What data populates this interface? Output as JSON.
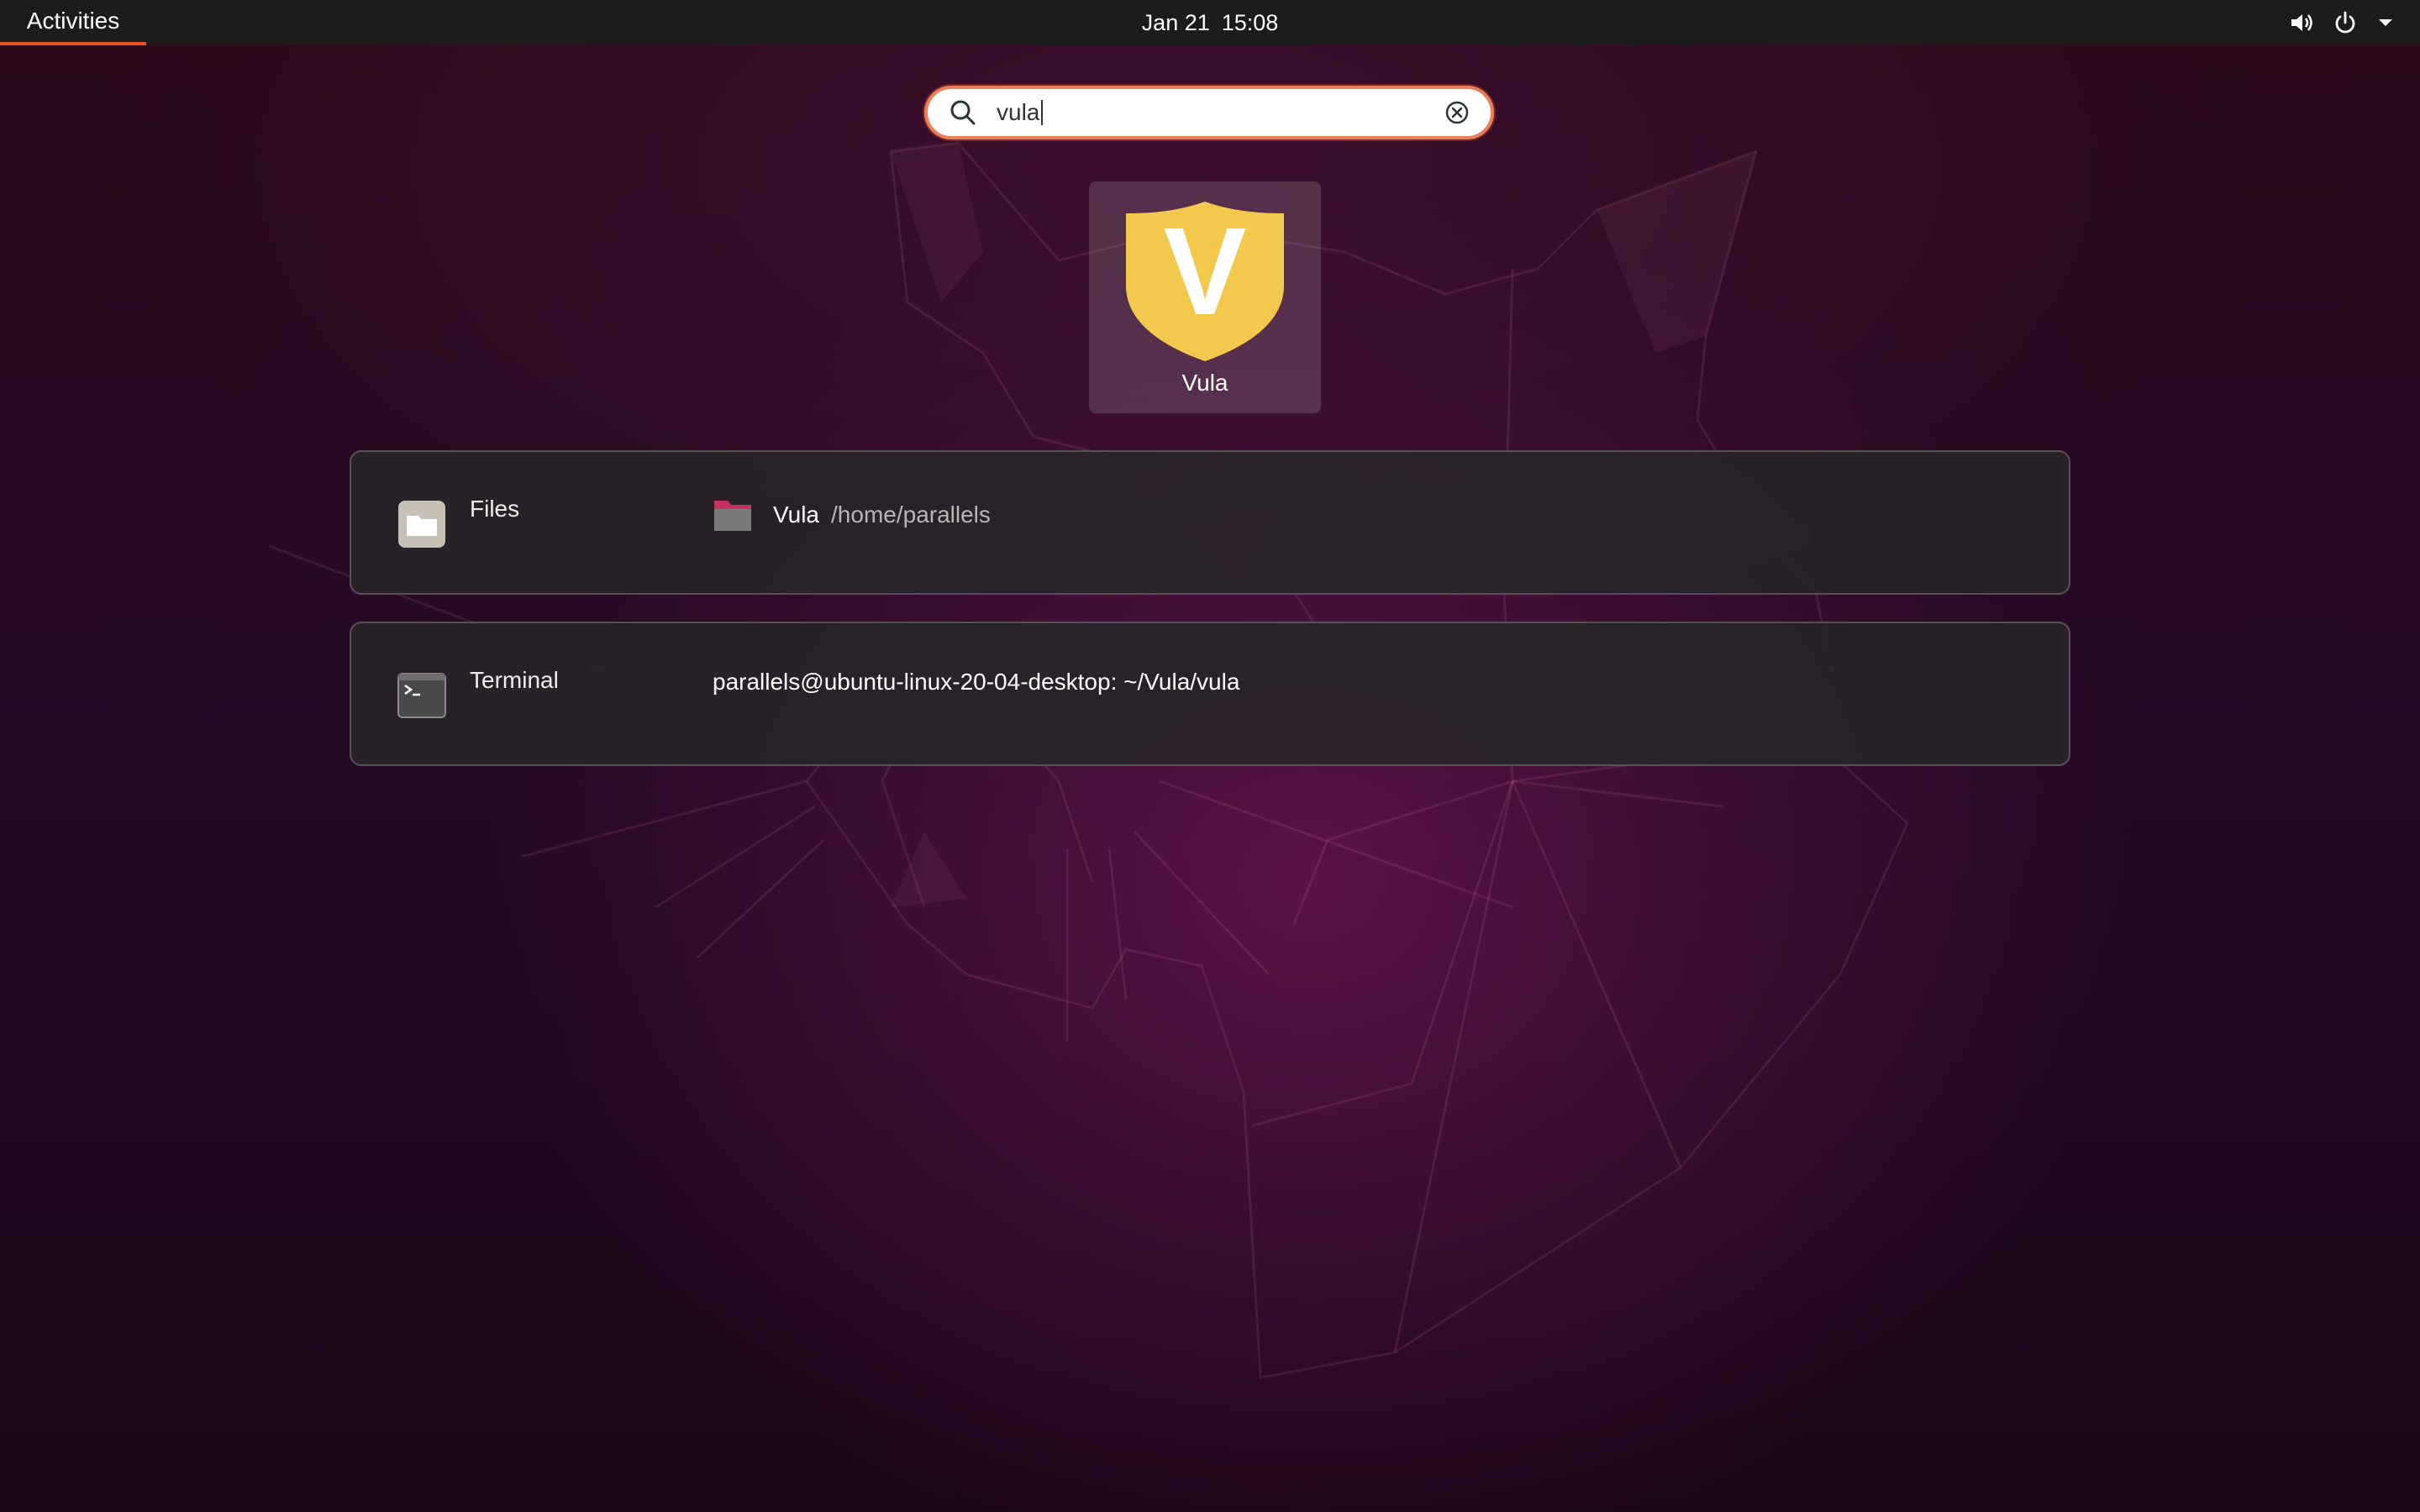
{
  "topbar": {
    "activities_label": "Activities",
    "date": "Jan 21",
    "time": "15:08",
    "tray_icons": [
      "volume-icon",
      "power-icon",
      "chevron-down-icon"
    ]
  },
  "search": {
    "query": "vula",
    "icons": [
      "search-icon",
      "clear-icon"
    ]
  },
  "app_result": {
    "name": "Vula",
    "icon_letter": "V",
    "icon_color": "#f2c94c"
  },
  "providers": [
    {
      "name": "Files",
      "icon": "folder-icon",
      "result_title": "Vula",
      "result_desc": "/home/parallels"
    },
    {
      "name": "Terminal",
      "icon": "terminal-icon",
      "result_title": "parallels@ubuntu-linux-20-04-desktop: ~/Vula/vula"
    }
  ],
  "colors": {
    "accent": "#e95420",
    "topbar": "#1c1c1c",
    "panel": "#282428"
  }
}
